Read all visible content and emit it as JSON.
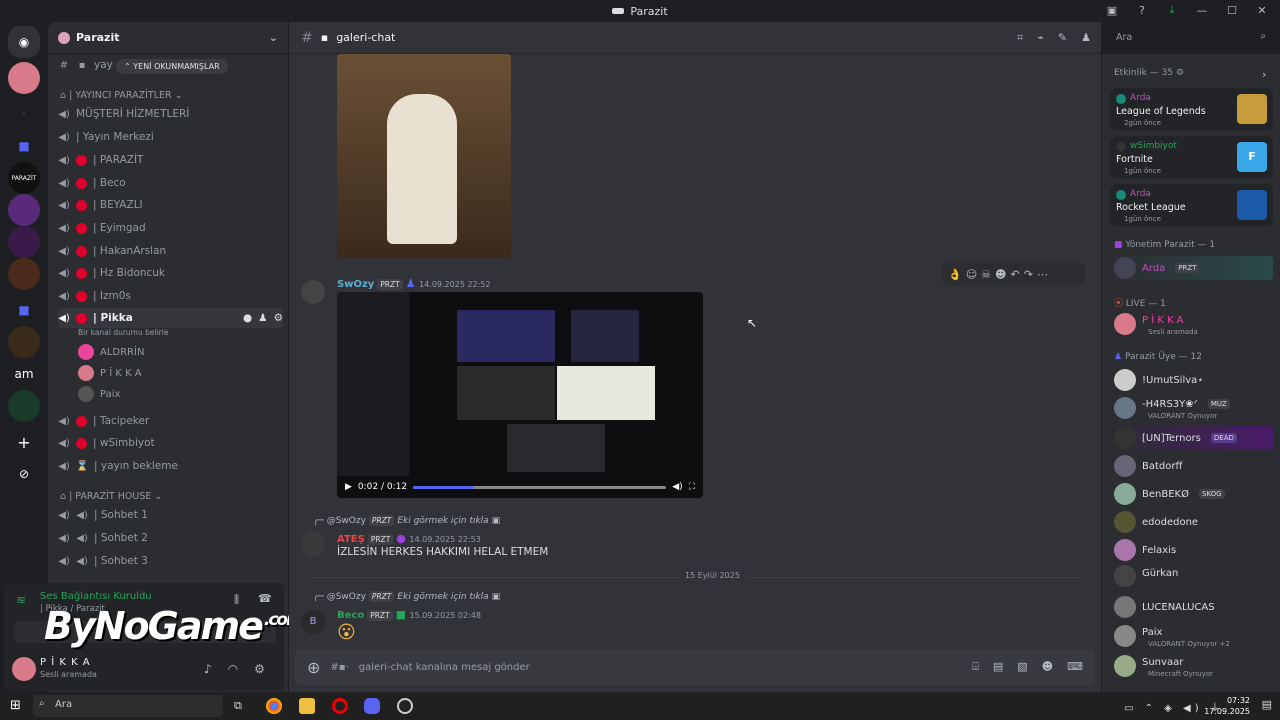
{
  "window": {
    "title": "Parazit"
  },
  "guild_sidebar": {
    "guild_labels": [
      "PARAZİT",
      "am"
    ]
  },
  "server": {
    "name": "Parazit"
  },
  "unread_banner": "YENİ OKUNMAMIŞLAR",
  "channels": {
    "top_partial": "yay",
    "categories": {
      "yayinci": "| YAYINCI PARAZİTLER",
      "house": "| PARAZİT HOUSE"
    },
    "items": [
      {
        "label": "MÜŞTERİ HİZMETLERİ"
      },
      {
        "label": "| Yayın Merkezi"
      },
      {
        "label": "| PARAZİT"
      },
      {
        "label": "| Beco"
      },
      {
        "label": "| BEYAZLI"
      },
      {
        "label": "| Eyimgad"
      },
      {
        "label": "| HakanArslan"
      },
      {
        "label": "| Hz Bidoncuk"
      },
      {
        "label": "| Izm0s"
      },
      {
        "label": "| Pikka"
      },
      {
        "label": "| Tacipeker"
      },
      {
        "label": "| wSimbiyot"
      },
      {
        "label": "| yayın bekleme"
      }
    ],
    "pikka_status": "Bir kanal durumu belirle",
    "voice_members": [
      "ALDRRİN",
      "P İ K K A",
      "Paix"
    ],
    "house_items": [
      "| Sohbet 1",
      "| Sohbet 2",
      "| Sohbet 3"
    ]
  },
  "voice_panel": {
    "status": "Ses Bağlantısı Kuruldu",
    "sub": "| Pikka / Parazit"
  },
  "watermark": {
    "text": "ByNoGame",
    "suffix": ".com"
  },
  "user": {
    "name": "P İ K K A",
    "status": "Sesli aramada"
  },
  "channel_header": {
    "name": "galeri-chat"
  },
  "search": {
    "placeholder": "Ara"
  },
  "messages": [
    {
      "user": "SwOzy",
      "tag": "PRZT",
      "time": "14.09.2025 22:52",
      "video_time": "0:02 / 0:12"
    },
    {
      "reply_to": "@SwOzy",
      "reply_tag": "PRZT",
      "reply_text": "Eki görmek için tıkla",
      "user": "ATEŞ",
      "tag": "PRZT",
      "time": "14.09.2025 22:53",
      "text": "İZLESİN HERKES HAKKIMI HELAL ETMEM"
    },
    {
      "reply_to": "@SwOzy",
      "reply_tag": "PRZT",
      "reply_text": "Eki görmek için tıkla",
      "user": "Beco",
      "tag": "PRZT",
      "time": "15.09.2025 02:48"
    }
  ],
  "date_divider": "15 Eylül 2025",
  "composer": {
    "placeholder": "galeri-chat kanalına mesaj gönder"
  },
  "right_panel": {
    "activity_header": "Etkinlik — 35",
    "activities": [
      {
        "user": "Arda",
        "game": "League of Legends",
        "when": "2gün önce"
      },
      {
        "user": "wSimbiyot",
        "game": "Fortnite",
        "when": "1gün önce"
      },
      {
        "user": "Arda",
        "game": "Rocket League",
        "when": "1gün önce"
      }
    ],
    "sections": {
      "yonetim": "Yönetim Parazit — 1",
      "live": "LIVE — 1",
      "uye": "Parazit Üye — 12"
    },
    "yonetim_member": {
      "name": "Arda",
      "tag": "PRZT"
    },
    "live_member": {
      "name": "P İ K K A",
      "sub": "Sesli aramada"
    },
    "members": [
      {
        "name": "!UmutSilva⋆",
        "sub": "",
        "badge": ""
      },
      {
        "name": "-H4RS3Y❀ᐟ",
        "sub": "VALORANT Oynuyor",
        "badge": "MUZ"
      },
      {
        "name": "[UN]Ternors",
        "sub": "",
        "badge": "DEAD"
      },
      {
        "name": "Batdorff",
        "sub": "",
        "badge": ""
      },
      {
        "name": "BenBEKØ",
        "sub": "",
        "badge": "SKOG"
      },
      {
        "name": "edodedone",
        "sub": "",
        "badge": ""
      },
      {
        "name": "Felaxis",
        "sub": "",
        "badge": ""
      },
      {
        "name": "Gürkan",
        "sub": "",
        "badge": ""
      },
      {
        "name": "LUCENALUCAS",
        "sub": "",
        "badge": ""
      },
      {
        "name": "Paix",
        "sub": "VALORANT Oynuyor +2",
        "badge": ""
      },
      {
        "name": "Sunvaar",
        "sub": "Minecraft Oynuyor",
        "badge": ""
      }
    ]
  },
  "taskbar": {
    "search": "Ara",
    "time": "07:32",
    "date": "17.09.2025"
  },
  "colors": {
    "accent": "#5865f2",
    "red_dot": "#e0002a",
    "green": "#23a55a",
    "pink_name": "#eb459e",
    "arda": "#c44fbf"
  }
}
